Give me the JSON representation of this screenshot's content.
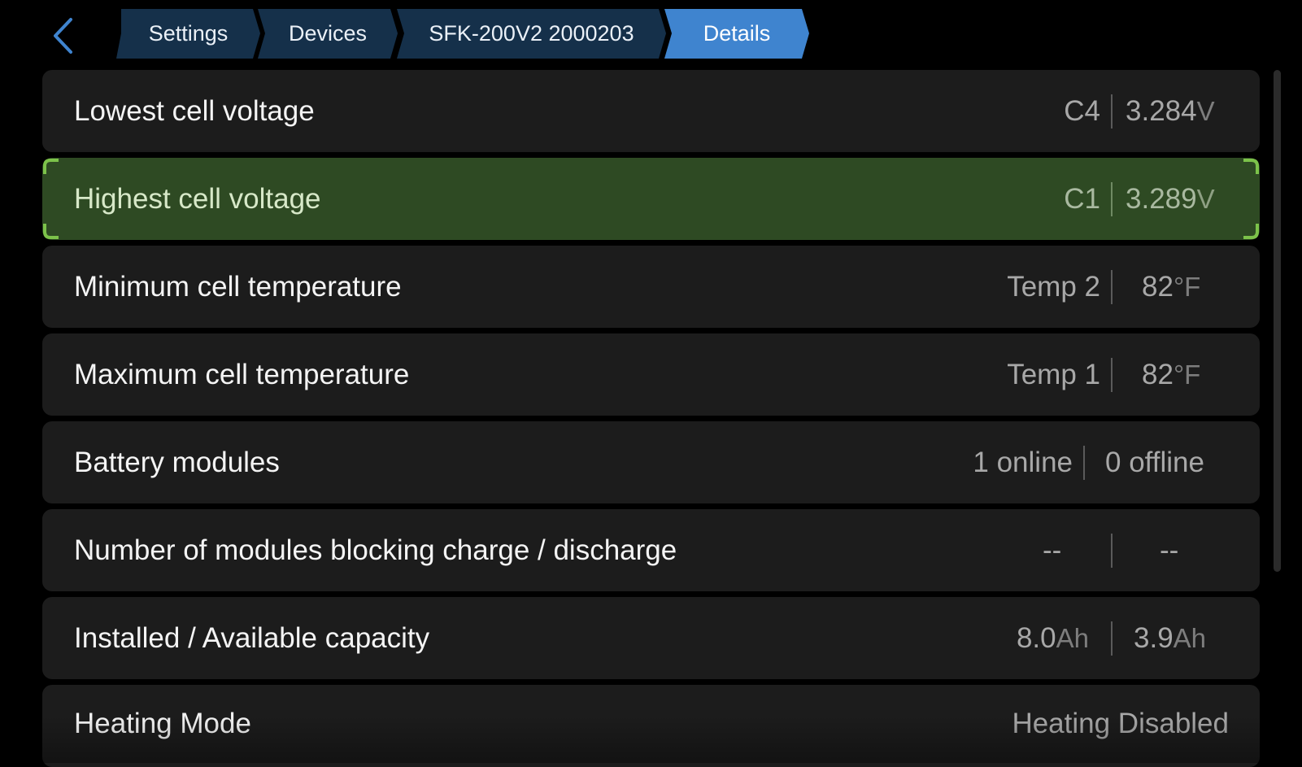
{
  "nav": {
    "breadcrumbs": [
      "Settings",
      "Devices",
      "SFK-200V2 2000203",
      "Details"
    ],
    "active_index": 3
  },
  "colors": {
    "crumb_bg": "#15304a",
    "crumb_active_bg": "#3f84cf",
    "row_bg": "#1c1c1c",
    "row_active_bg": "#2e4a23",
    "focus_accent": "#7cc24a",
    "back_arrow": "#3f84cf"
  },
  "rows": [
    {
      "label": "Lowest cell voltage",
      "left": "C4",
      "right": "3.284",
      "right_unit": "V"
    },
    {
      "label": "Highest cell voltage",
      "left": "C1",
      "right": "3.289",
      "right_unit": "V",
      "selected": true
    },
    {
      "label": "Minimum cell temperature",
      "left": "Temp 2",
      "right": "82",
      "right_unit": "°F"
    },
    {
      "label": "Maximum cell temperature",
      "left": "Temp 1",
      "right": "82",
      "right_unit": "°F"
    },
    {
      "label": "Battery modules",
      "left": "1 online",
      "right": "0 offline"
    },
    {
      "label": "Number of modules blocking charge / discharge",
      "left": "--",
      "right": "--"
    },
    {
      "label": "Installed / Available capacity",
      "left": "8.0",
      "left_unit": "Ah",
      "right": "3.9",
      "right_unit": "Ah"
    },
    {
      "label": "Heating Mode",
      "value": "Heating Disabled"
    }
  ],
  "icons": {
    "back": "chevron-left-icon"
  }
}
